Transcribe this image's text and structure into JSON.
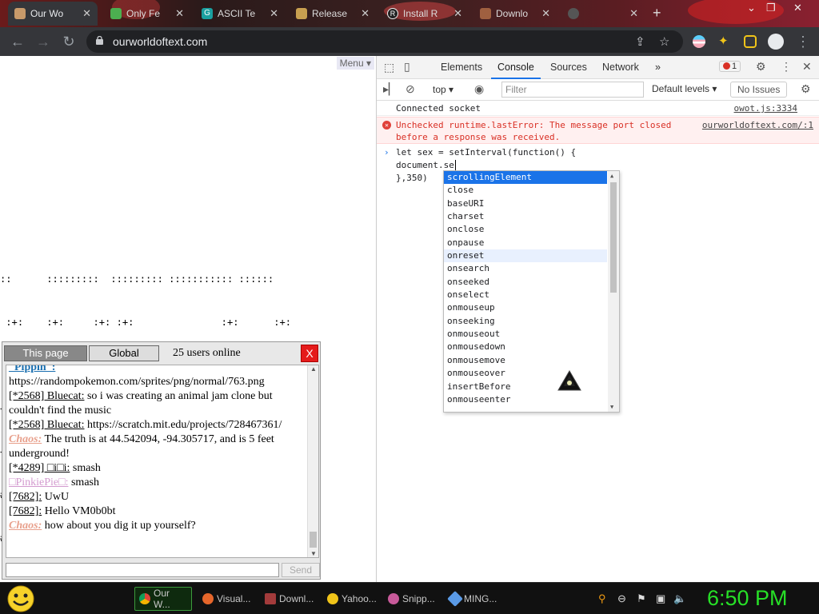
{
  "browser": {
    "tabs": [
      {
        "title": "Our Wo",
        "active": true
      },
      {
        "title": "Only Fe",
        "active": false
      },
      {
        "title": "ASCII Te",
        "active": false
      },
      {
        "title": "Release",
        "active": false
      },
      {
        "title": "Install R",
        "active": false
      },
      {
        "title": "Downlo",
        "active": false
      },
      {
        "title": "",
        "active": false
      }
    ],
    "new_tab": "+",
    "url": "ourworldoftext.com"
  },
  "page": {
    "menu_label": "Menu",
    "ascii_art": [
      "::      :::::::::  ::::::::: ::::::::::: ::::::",
      " :+:    :+:     :+: :+:               :+:      :+:",
      " +:+   +:+     +:+ +:+              +:+      +:+",
      "+++:  +#++:++#+:  :#+:+::+:#          +#+      +#++:++#",
      "+#+ +#+     +#+ +#+              +#+      +#+",
      "#+#  #+#     #+#  #+#            #+#      #+#",
      "#  ###     ###  ###          ###########  ##########  "
    ]
  },
  "chat": {
    "tab_this_page": "This page",
    "tab_global": "Global",
    "online": "25 users online",
    "close": "X",
    "send": "Send",
    "messages": [
      {
        "name": "_Pippin_:",
        "text": " https://randompokemon.com/sprites/png/normal/763.png",
        "style": "blue"
      },
      {
        "name": "[*2568] Bluecat:",
        "text": " so i was creating an animal jam clone but couldn't find the music",
        "style": "plain"
      },
      {
        "name": "[*2568] Bluecat:",
        "text": " https://scratch.mit.edu/projects/728467361/",
        "style": "plain"
      },
      {
        "name": "Chaos:",
        "text": " The truth is at 44.542094, -94.305717, and is 5 feet underground!",
        "style": "chaos"
      },
      {
        "name": "[*4289] □i□i:",
        "text": " smash",
        "style": "plain"
      },
      {
        "name": "□PinkiePie□:",
        "text": " smash",
        "style": "pink"
      },
      {
        "name": "[7682]:",
        "text": " UwU",
        "style": "plain"
      },
      {
        "name": "[7682]:",
        "text": " Hello VM0b0bt",
        "style": "plain"
      },
      {
        "name": "Chaos:",
        "text": " how about you dig it up yourself?",
        "style": "chaos"
      }
    ]
  },
  "devtools": {
    "tabs": [
      "Elements",
      "Console",
      "Sources",
      "Network"
    ],
    "more": "»",
    "error_count": "1",
    "context": "top",
    "filter_placeholder": "Filter",
    "levels": "Default levels",
    "no_issues": "No Issues",
    "log1": {
      "text": "Connected socket",
      "source": "owot.js:3334"
    },
    "error": {
      "line1": "Unchecked runtime.lastError: The message port closed",
      "line2": "before a response was received.",
      "source": "ourworldoftext.com/:1"
    },
    "input_lines": [
      "let sex = setInterval(function() {",
      "document.se",
      "},350)"
    ],
    "autocomplete": [
      "scrollingElement",
      "close",
      "baseURI",
      "charset",
      "onclose",
      "onpause",
      "onreset",
      "onsearch",
      "onseeked",
      "onselect",
      "onmouseup",
      "onseeking",
      "onmouseout",
      "onmousedown",
      "onmousemove",
      "onmouseover",
      "insertBefore",
      "onmouseenter"
    ]
  },
  "taskbar": {
    "items": [
      {
        "label": "Our W...",
        "color": "#e8a33c",
        "active": true
      },
      {
        "label": "Visual...",
        "color": "#e6662b",
        "active": false
      },
      {
        "label": "Downl...",
        "color": "#a33b3b",
        "active": false
      },
      {
        "label": "Yahoo...",
        "color": "#f0c419",
        "active": false
      },
      {
        "label": "Snipp...",
        "color": "#c85a9a",
        "active": false
      },
      {
        "label": "MING...",
        "color": "#5a9ae6",
        "active": false
      }
    ],
    "clock": "6:50 PM"
  },
  "colors": {
    "accent": "#1a73e8",
    "error": "#d93025",
    "clock": "#27e027"
  }
}
